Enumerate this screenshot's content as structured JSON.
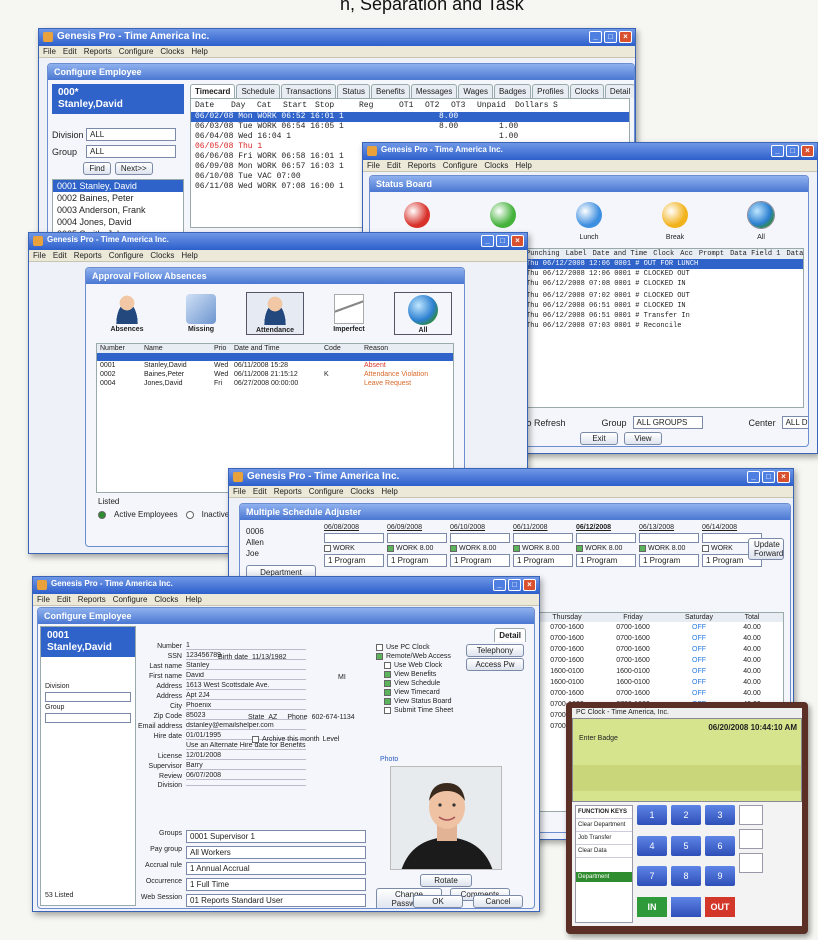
{
  "caption": "n, Separation and Task",
  "app_title": "Genesis Pro - Time America Inc.",
  "menu": [
    "File",
    "Edit",
    "Reports",
    "Configure",
    "Clocks",
    "Help"
  ],
  "timecard": {
    "panel_title": "Configure Employee",
    "emp_number": "000*",
    "emp_name": "Stanley,David",
    "division_label": "Division",
    "division_value": "ALL",
    "group_label": "Group",
    "group_value": "ALL",
    "find": "Find",
    "next": "Next>>",
    "employees": [
      "0001 Stanley, David",
      "0002 Baines, Peter",
      "0003 Anderson, Frank",
      "0004 Jones, David",
      "0005 Smith, John"
    ],
    "tabs": [
      "Timecard",
      "Schedule",
      "Transactions",
      "Status",
      "Benefits",
      "Messages",
      "Wages",
      "Badges",
      "Profiles",
      "Clocks",
      "Detail"
    ],
    "headers": [
      "Date",
      "Day",
      "Cat",
      "Start",
      "Stop",
      "Reg",
      "OT1",
      "OT2",
      "OT3",
      "Unpaid",
      "Dollars",
      "S"
    ],
    "rows": [
      {
        "line": "06/02/08 Mon WORK  06:52 16:01 1",
        "reg": "8.00",
        "unpaid": "",
        "flag": "hl"
      },
      {
        "line": "06/03/08 Tue WORK  06:54 16:05 1",
        "reg": "8.00",
        "unpaid": "1.00",
        "flag": ""
      },
      {
        "line": "06/04/08 Wed             16:04 1",
        "reg": "",
        "unpaid": "1.00",
        "flag": "ex"
      },
      {
        "line": "06/05/08 Thu                   1",
        "reg": "",
        "unpaid": "",
        "flag": "red"
      },
      {
        "line": "06/06/08 Fri WORK  06:58 16:01 1",
        "reg": "",
        "unpaid": "",
        "flag": ""
      },
      {
        "line": "06/09/08 Mon WORK  06:57 16:03 1",
        "reg": "",
        "unpaid": "",
        "flag": ""
      },
      {
        "line": "06/10/08 Tue VAC   07:00",
        "reg": "",
        "unpaid": "",
        "flag": ""
      },
      {
        "line": "06/11/08 Wed WORK  07:08 16:00 1",
        "reg": "",
        "unpaid": "",
        "flag": ""
      }
    ]
  },
  "status": {
    "panel_title": "Status Board",
    "orbs": [
      {
        "label": "Work",
        "color": "#d8312a"
      },
      {
        "label": "Working",
        "color": "#45b23b"
      },
      {
        "label": "Lunch",
        "color": "#3e8fe0"
      },
      {
        "label": "Break",
        "color": "#f2b21c"
      },
      {
        "label": "All",
        "color": "globe"
      }
    ],
    "headers": [
      "Punching",
      "Label",
      "Date and Time",
      "Clock",
      "Acc",
      "Prompt",
      "Data Field 1",
      "Data Field 2"
    ],
    "rows": [
      "Thu 06/12/2008 12:06 0001  #  OUT FOR LUNCH",
      "Thu 06/12/2008 12:06 0001  #  CLOCKED OUT",
      "Thu 06/12/2008 07:08 0001  #  CLOCKED IN",
      "",
      "Thu 06/12/2008 07:02 0001  #  CLOCKED OUT",
      "Thu 06/12/2008 06:51 0001  #  CLOCKED IN",
      "Thu 06/12/2008 06:51 0001  #  Transfer In",
      "Thu 06/12/2008 07:03 0001  #  Reconcile"
    ],
    "footer_label": "No Refresh",
    "group_label": "Group",
    "group_value": "ALL GROUPS",
    "center_label": "Center",
    "center_value": "ALL DIVISIONS",
    "exit": "Exit",
    "view": "View"
  },
  "absence": {
    "panel_title": "Approval Follow Absences",
    "icons": [
      {
        "label": "Absences",
        "kind": "person"
      },
      {
        "label": "Missing",
        "kind": "missing"
      },
      {
        "label": "Attendance",
        "kind": "person"
      },
      {
        "label": "Imperfect",
        "kind": "pen"
      },
      {
        "label": "All",
        "kind": "globe"
      }
    ],
    "headers": [
      "Number",
      "Name",
      "Prio",
      "Date and Time",
      "Code",
      "Reason"
    ],
    "rows": [
      {
        "num": "0001",
        "name": "Stanley,David",
        "prio": "Wed",
        "dt": "06/11/2008 15:28",
        "code": "",
        "reason": "Absent",
        "color": "#d83a2a",
        "hl": false
      },
      {
        "num": "0002",
        "name": "Baines,Peter",
        "prio": "Wed",
        "dt": "06/11/2008 21:15:12",
        "code": "K",
        "reason": "Attendance Violation",
        "color": "#d86a2a",
        "hl": false
      },
      {
        "num": "0004",
        "name": "Jones,David",
        "prio": "Fri",
        "dt": "06/27/2008 00:00:00",
        "code": "",
        "reason": "Leave Request",
        "color": "#d86a2a",
        "hl": false
      }
    ],
    "footer": "Listed",
    "active": "Active Employees",
    "inactive": "Inactive Employees"
  },
  "scheduler": {
    "panel_title": "Multiple Schedule Adjuster",
    "emp_number": "0006",
    "emp_line2": "Allen",
    "emp_line3": "Joe",
    "department": "Department",
    "dates": [
      "06/08/2008",
      "06/09/2008",
      "06/10/2008",
      "06/11/2008",
      "06/12/2008",
      "06/13/2008",
      "06/14/2008"
    ],
    "cat": "WORK",
    "hours": "8.00",
    "program": "1 Program",
    "update": "Update Forward",
    "grid_headers": [
      "Thursday",
      "Friday",
      "Saturday",
      "Total"
    ],
    "grid_rows": [
      [
        "0700-1600",
        "0700-1600",
        "OFF",
        "40.00"
      ],
      [
        "0700-1600",
        "0700-1600",
        "OFF",
        "40.00"
      ],
      [
        "0700-1600",
        "0700-1600",
        "OFF",
        "40.00"
      ],
      [
        "0700-1600",
        "0700-1600",
        "OFF",
        "40.00"
      ],
      [
        "1600-0100",
        "1600-0100",
        "OFF",
        "40.00"
      ],
      [
        "1600-0100",
        "1600-0100",
        "OFF",
        "40.00"
      ],
      [
        "0700-1600",
        "0700-1600",
        "OFF",
        "40.00"
      ],
      [
        "0700-1600",
        "0700-1600",
        "OFF",
        "40.00"
      ],
      [
        "0700-1600",
        "0700-1600",
        "OFF",
        "40.00"
      ],
      [
        "0700-1600",
        "0700-1600",
        "OFF",
        "32.00"
      ]
    ]
  },
  "detail": {
    "panel_title": "Configure Employee",
    "emp_number": "0001",
    "emp_name": "Stanley,David",
    "division_label": "Division",
    "group_label": "Group",
    "tab": "Detail",
    "fields": [
      {
        "label": "Number",
        "value": "1"
      },
      {
        "label": "SSN",
        "value": "123456789"
      },
      {
        "label": "Last name",
        "value": "Stanley"
      },
      {
        "label": "First name",
        "value": "David"
      },
      {
        "label": "Address",
        "value": "1613 West Scottsdale Ave."
      },
      {
        "label": "Address",
        "value": "Apt 2J4"
      },
      {
        "label": "City",
        "value": "Phoenix"
      },
      {
        "label": "Zip Code",
        "value": "85023"
      },
      {
        "label": "Email address",
        "value": "dstanley@emailshelper.com"
      },
      {
        "label": "Hire date",
        "value": "01/01/1995"
      },
      {
        "label": "",
        "value": "Use an Alternate Hire date for Benefits"
      },
      {
        "label": "License",
        "value": "12/01/2008"
      },
      {
        "label": "Supervisor",
        "value": "Barry"
      },
      {
        "label": "Review",
        "value": "06/07/2008"
      },
      {
        "label": "Division",
        "value": ""
      }
    ],
    "birth_label": "Birth date",
    "birth_value": "11/13/1982",
    "state_label": "State",
    "state_value": "AZ",
    "phone_label": "Phone",
    "phone_value": "602-674-1134",
    "mi_label": "MI",
    "archive": "Archive this month",
    "level": "Level",
    "selects": [
      {
        "label": "Groups",
        "value": "0001  Supervisor 1"
      },
      {
        "label": "Pay group",
        "value": "All Workers"
      },
      {
        "label": "Accrual rule",
        "value": "1  Annual Accrual"
      },
      {
        "label": "Occurrence",
        "value": "1  Full Time"
      },
      {
        "label": "Web Session",
        "value": "01  Reports Standard User"
      }
    ],
    "checks": [
      "Use PC Clock",
      "Remote/Web Access",
      "Use Web Clock",
      "View Benefits",
      "View Schedule",
      "View Timecard",
      "View Status Board",
      "Submit Time Sheet"
    ],
    "telephony": "Telephony",
    "access_pw": "Access Pw",
    "photo_label": "Photo",
    "rotate": "Rotate",
    "change_pw": "Change Password",
    "comments": "Comments",
    "listed": "53 Listed",
    "ok": "OK",
    "cancel": "Cancel"
  },
  "pcclock": {
    "title": "PC Clock - Time America, Inc.",
    "timestamp": "06/20/2008 10:44:10 AM",
    "screen_text": "Enter Badge",
    "function_keys": [
      "FUNCTION KEYS",
      "Clear Department",
      "Job Transfer",
      "Clear Data"
    ],
    "keys": [
      "1",
      "2",
      "3",
      "4",
      "5",
      "6",
      "7",
      "8",
      "9"
    ],
    "in": "IN",
    "out": "OUT",
    "bottom_keys": [
      "Department"
    ]
  }
}
